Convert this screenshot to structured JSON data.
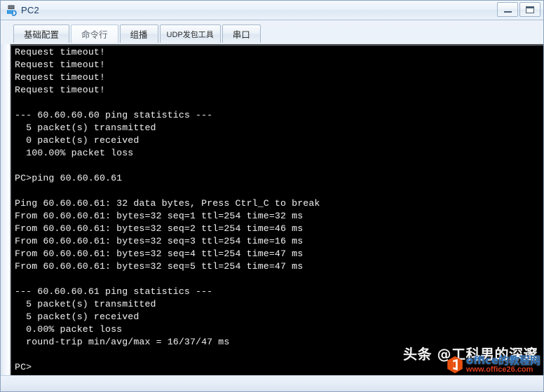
{
  "window": {
    "title": "PC2",
    "icon": "pc-device-icon",
    "buttons": {
      "minimize": "minimize-icon",
      "maximize": "maximize-icon"
    }
  },
  "tabs": [
    {
      "label": "基础配置",
      "active": false
    },
    {
      "label": "命令行",
      "active": true
    },
    {
      "label": "组播",
      "active": false
    },
    {
      "label": "UDP发包工具",
      "active": false
    },
    {
      "label": "串口",
      "active": false
    }
  ],
  "terminal": {
    "prompt": "PC>",
    "lines": [
      "Request timeout!",
      "Request timeout!",
      "Request timeout!",
      "Request timeout!",
      "",
      "--- 60.60.60.60 ping statistics ---",
      "  5 packet(s) transmitted",
      "  0 packet(s) received",
      "  100.00% packet loss",
      "",
      "PC>ping 60.60.60.61",
      "",
      "Ping 60.60.60.61: 32 data bytes, Press Ctrl_C to break",
      "From 60.60.60.61: bytes=32 seq=1 ttl=254 time=32 ms",
      "From 60.60.60.61: bytes=32 seq=2 ttl=254 time=46 ms",
      "From 60.60.60.61: bytes=32 seq=3 ttl=254 time=16 ms",
      "From 60.60.60.61: bytes=32 seq=4 ttl=254 time=47 ms",
      "From 60.60.60.61: bytes=32 seq=5 ttl=254 time=47 ms",
      "",
      "--- 60.60.60.61 ping statistics ---",
      "  5 packet(s) transmitted",
      "  5 packet(s) received",
      "  0.00% packet loss",
      "  round-trip min/avg/max = 16/37/47 ms",
      "",
      "PC>"
    ]
  },
  "watermarks": {
    "toutiao": "头条 @工科男的深邃",
    "office_cn": "office的教程网",
    "office_url": "www.office26.com"
  },
  "colors": {
    "terminal_bg": "#000000",
    "terminal_fg": "#e6e6e6",
    "title_text": "#1c3d66",
    "watermark_blue": "#2b6fb8",
    "watermark_red": "#d83b1e"
  }
}
